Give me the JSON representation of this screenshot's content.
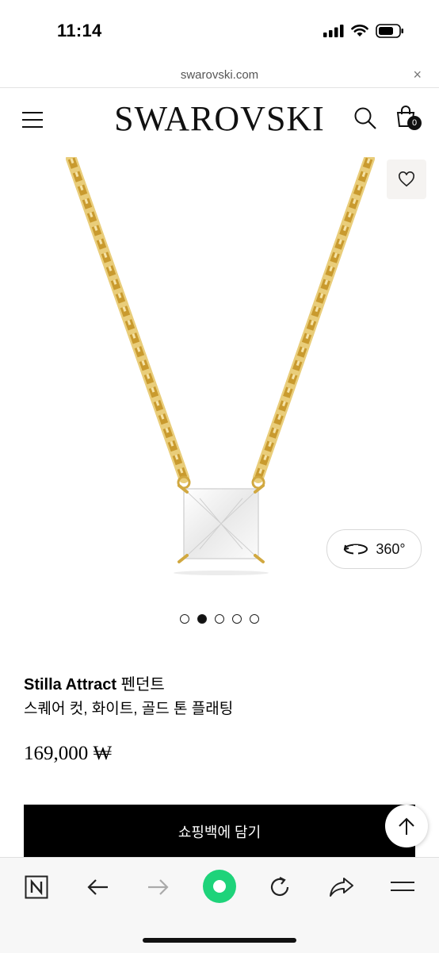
{
  "status_bar": {
    "time": "11:14"
  },
  "browser": {
    "url": "swarovski.com",
    "close": "×"
  },
  "header": {
    "logo": "SWAROVSKI",
    "cart_count": "0"
  },
  "product": {
    "view_360": "360°",
    "gallery": {
      "total": 5,
      "active_index": 1
    },
    "name_bold": "Stilla Attract",
    "name_rest": " 펜던트",
    "subtitle": "스퀘어 컷, 화이트, 골드 톤 플래팅",
    "price": "169,000 ₩",
    "add_to_cart": "쇼핑백에 담기"
  },
  "colors": {
    "chain": "#d9b24a",
    "button": "#000000",
    "browser_accent": "#1ed37a"
  }
}
